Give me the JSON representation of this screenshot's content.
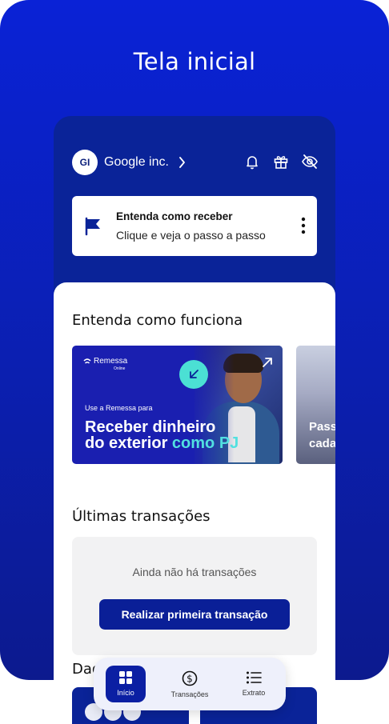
{
  "stage": {
    "title": "Tela inicial"
  },
  "header": {
    "avatar_initials": "GI",
    "company_name": "Google inc."
  },
  "banner": {
    "title": "Entenda como receber",
    "subtitle": "Clique e veja o passo a passo"
  },
  "section_how": {
    "title": "Entenda como funciona",
    "card1": {
      "brand": "Remessa",
      "brand_sub": "Online",
      "small": "Use a Remessa para",
      "line1": "Receber dinheiro",
      "line2_a": "do exterior ",
      "line2_b": "como PJ"
    },
    "card2": {
      "line1": "Passo",
      "line2": "cada"
    }
  },
  "transactions": {
    "title": "Últimas transações",
    "empty": "Ainda não há transações",
    "cta": "Realizar primeira transação"
  },
  "dados": {
    "title": "Dad"
  },
  "nav": {
    "items": [
      {
        "label": "Início"
      },
      {
        "label": "Transações"
      },
      {
        "label": "Extrato"
      }
    ]
  },
  "colors": {
    "brand": "#0a2398",
    "accent": "#52e0e0"
  }
}
